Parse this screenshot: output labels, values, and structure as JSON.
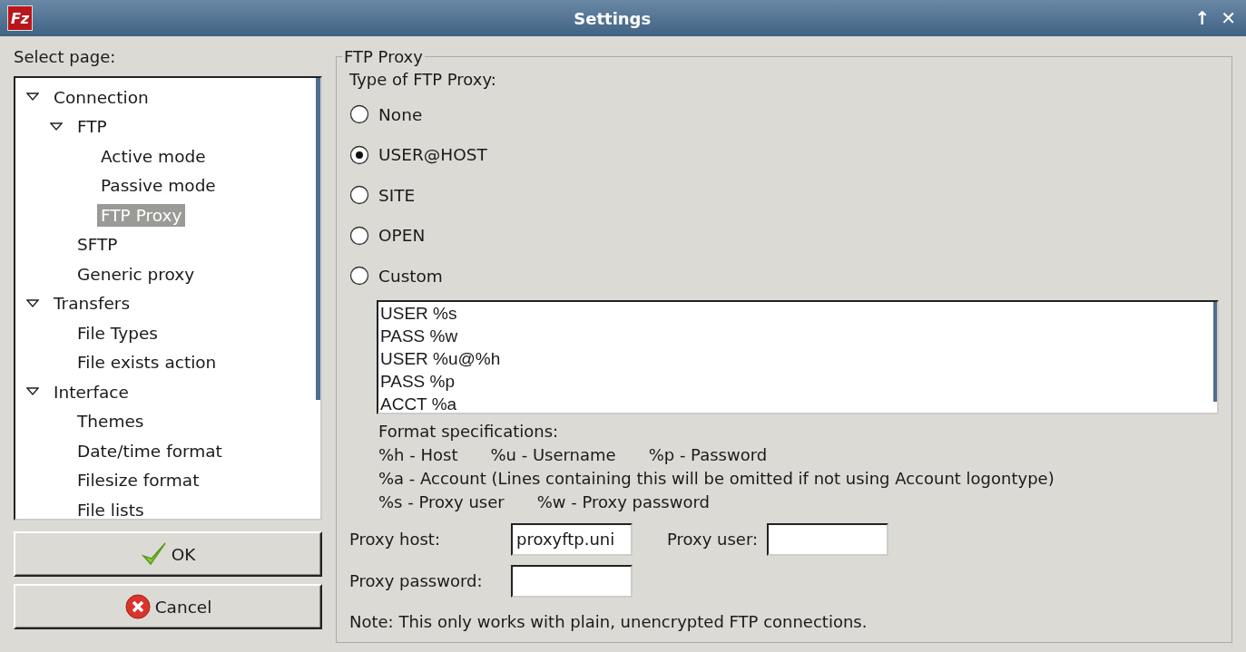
{
  "window": {
    "title": "Settings",
    "app_icon_text": "Fz",
    "controls": [
      "↑",
      "✕"
    ]
  },
  "sidebar": {
    "label": "Select page:",
    "tree": [
      {
        "label": "Connection",
        "expanded": true,
        "selected": false,
        "children": [
          {
            "label": "FTP",
            "expanded": true,
            "selected": false,
            "children": [
              {
                "label": "Active mode",
                "selected": false
              },
              {
                "label": "Passive mode",
                "selected": false
              },
              {
                "label": "FTP Proxy",
                "selected": true
              }
            ]
          },
          {
            "label": "SFTP",
            "selected": false
          },
          {
            "label": "Generic proxy",
            "selected": false
          }
        ]
      },
      {
        "label": "Transfers",
        "expanded": true,
        "selected": false,
        "children": [
          {
            "label": "File Types",
            "selected": false
          },
          {
            "label": "File exists action",
            "selected": false
          }
        ]
      },
      {
        "label": "Interface",
        "expanded": true,
        "selected": false,
        "children": [
          {
            "label": "Themes",
            "selected": false
          },
          {
            "label": "Date/time format",
            "selected": false
          },
          {
            "label": "Filesize format",
            "selected": false
          },
          {
            "label": "File lists",
            "selected": false
          }
        ]
      }
    ]
  },
  "buttons": [
    {
      "label": "OK",
      "kind": "ok"
    },
    {
      "label": "Cancel",
      "kind": "cancel"
    }
  ],
  "group": {
    "title": "FTP Proxy",
    "type_label": "Type of FTP Proxy:",
    "options": [
      {
        "label": "None",
        "selected": false
      },
      {
        "label": "USER@HOST",
        "selected": true
      },
      {
        "label": "SITE",
        "selected": false
      },
      {
        "label": "OPEN",
        "selected": false
      },
      {
        "label": "Custom",
        "selected": false
      }
    ],
    "custom_lines": [
      "USER %s",
      "PASS %w",
      "USER %u@%h",
      "PASS %p",
      "ACCT %a"
    ],
    "format_title": "Format specifications:",
    "format_rows": [
      [
        "%h - Host",
        "%u - Username",
        "%p - Password"
      ],
      [
        "%a - Account (Lines containing this will be omitted if not using Account logontype)"
      ],
      [
        "%s - Proxy user",
        "%w - Proxy password"
      ]
    ],
    "proxy_host": {
      "label": "Proxy host:",
      "value": "proxyftp.uni"
    },
    "proxy_user": {
      "label": "Proxy user:"
    },
    "proxy_password": {
      "label": "Proxy password:"
    },
    "note": "Note: This only works with plain, unencrypted FTP connections."
  }
}
